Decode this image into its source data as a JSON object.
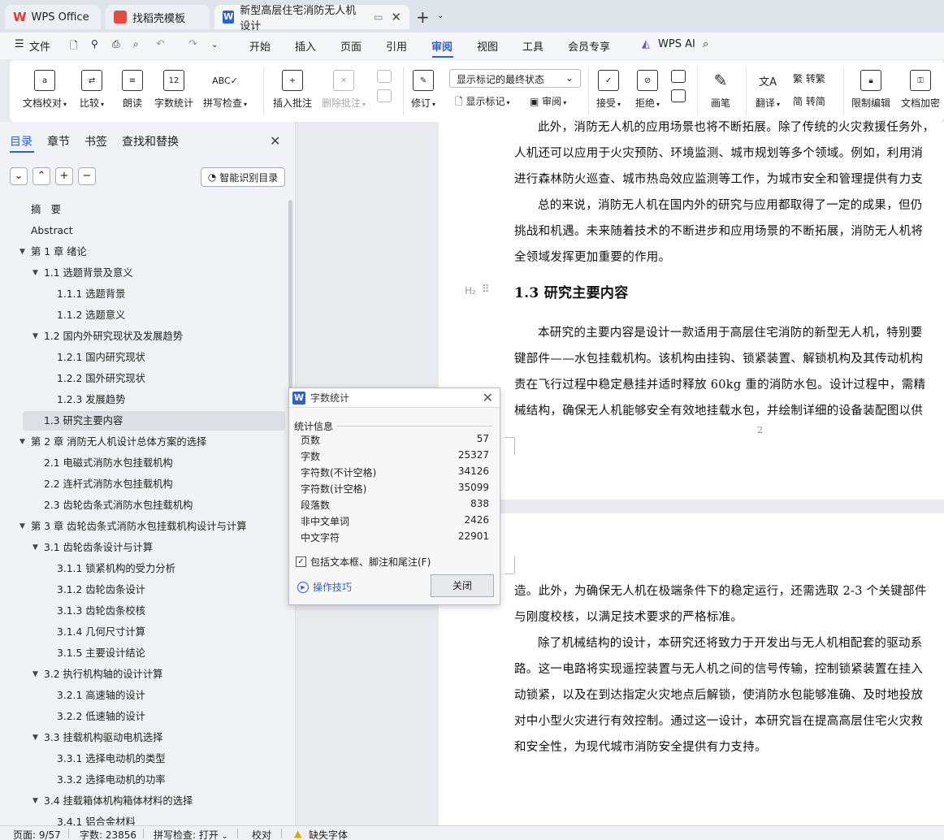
{
  "tabs": {
    "wps": "WPS Office",
    "template": "找稻壳模板",
    "doc": "新型高层住宅消防无人机设计"
  },
  "menu": {
    "file": "文件",
    "items": [
      "开始",
      "插入",
      "页面",
      "引用",
      "审阅",
      "视图",
      "工具",
      "会员专享"
    ],
    "active": "审阅",
    "ai": "WPS AI"
  },
  "ribbon": {
    "doc_check": "文档校对",
    "compare": "比较",
    "read_aloud": "朗读",
    "word_count": "字数统计",
    "spell_check": "拼写检查",
    "insert_comment": "插入批注",
    "delete_comment": "删除批注",
    "revise": "修订",
    "markup_select": "显示标记的最终状态",
    "show_markup": "显示标记",
    "review": "审阅",
    "accept": "接受",
    "reject": "拒绝",
    "pen": "画笔",
    "translate": "翻译",
    "to_traditional": "转繁",
    "to_simplified": "转简",
    "restrict_edit": "限制编辑",
    "encrypt": "文档加密"
  },
  "nav": {
    "tabs": [
      "目录",
      "章节",
      "书签",
      "查找和替换"
    ],
    "smart_btn": "智能识别目录",
    "items": [
      {
        "text": "摘　要",
        "level": 0
      },
      {
        "text": "Abstract",
        "level": 0
      },
      {
        "text": "第 1 章  绪论",
        "level": 0,
        "caret": true
      },
      {
        "text": "1.1  选题背景及意义",
        "level": 1,
        "caret": true
      },
      {
        "text": "1.1.1  选题背景",
        "level": 2
      },
      {
        "text": "1.1.2  选题意义",
        "level": 2
      },
      {
        "text": "1.2  国内外研究现状及发展趋势",
        "level": 1,
        "caret": true
      },
      {
        "text": "1.2.1  国内研究现状",
        "level": 2
      },
      {
        "text": "1.2.2  国外研究现状",
        "level": 2
      },
      {
        "text": "1.2.3  发展趋势",
        "level": 2
      },
      {
        "text": "1.3  研究主要内容",
        "level": 1,
        "selected": true
      },
      {
        "text": "第 2 章  消防无人机设计总体方案的选择",
        "level": 0,
        "caret": true
      },
      {
        "text": "2.1  电磁式消防水包挂载机构",
        "level": 1
      },
      {
        "text": "2.2  连杆式消防水包挂载机构",
        "level": 1
      },
      {
        "text": "2.3  齿轮齿条式消防水包挂载机构",
        "level": 1
      },
      {
        "text": "第 3 章  齿轮齿条式消防水包挂载机构设计与计算",
        "level": 0,
        "caret": true
      },
      {
        "text": "3.1  齿轮齿条设计与计算",
        "level": 1,
        "caret": true
      },
      {
        "text": "3.1.1  锁紧机构的受力分析",
        "level": 2
      },
      {
        "text": "3.1.2  齿轮齿条设计",
        "level": 2
      },
      {
        "text": "3.1.3  齿轮齿条校核",
        "level": 2
      },
      {
        "text": "3.1.4  几何尺寸计算",
        "level": 2
      },
      {
        "text": "3.1.5  主要设计结论",
        "level": 2
      },
      {
        "text": "3.2  执行机构轴的设计计算",
        "level": 1,
        "caret": true
      },
      {
        "text": "3.2.1  高速轴的设计",
        "level": 2
      },
      {
        "text": "3.2.2  低速轴的设计",
        "level": 2
      },
      {
        "text": "3.3    挂载机构驱动电机选择",
        "level": 1,
        "caret": true
      },
      {
        "text": "3.3.1    选择电动机的类型",
        "level": 2
      },
      {
        "text": "3.3.2    选择电动机的功率",
        "level": 2
      },
      {
        "text": "3.4  挂载箱体机构箱体材料的选择",
        "level": 1,
        "caret": true
      },
      {
        "text": "3.4.1  铝合金材料",
        "level": 2
      }
    ]
  },
  "document": {
    "page1_lines": [
      "此外，消防无人机的应用场景也将不断拓展。除了传统的火灾救援任务外，",
      "人机还可以应用于火灾预防、环境监测、城市规划等多个领域。例如，利用消",
      "进行森林防火巡查、城市热岛效应监测等工作，为城市安全和管理提供有力支",
      "总的来说，消防无人机在国内外的研究与应用都取得了一定的成果，但仍",
      "挑战和机遇。未来随着技术的不断进步和应用场景的不断拓展，消防无人机将",
      "全领域发挥更加重要的作用。"
    ],
    "heading_marker": "H₂",
    "heading": "1.3  研究主要内容",
    "page1_lines_b": [
      "本研究的主要内容是设计一款适用于高层住宅消防的新型无人机，特别要",
      "键部件——水包挂载机构。该机构由挂钩、锁紧装置、解锁机构及其传动机构",
      "责在飞行过程中稳定悬挂并适时释放 60kg 重的消防水包。设计过程中，需精",
      "械结构，确保无人机能够安全有效地挂载水包，并绘制详细的设备装配图以供"
    ],
    "page_number": "2",
    "page2_lines": [
      "造。此外，为确保无人机在极端条件下的稳定运行，还需选取 2-3 个关键部件",
      "与刚度校核，以满足技术要求的严格标准。",
      "除了机械结构的设计，本研究还将致力于开发出与无人机相配套的驱动系",
      "路。这一电路将实现遥控装置与无人机之间的信号传输，控制锁紧装置在挂入",
      "动锁紧，以及在到达指定火灾地点后解锁，使消防水包能够准确、及时地投放",
      "对中小型火灾进行有效控制。通过这一设计，本研究旨在提高高层住宅火灾救",
      "和安全性，为现代城市消防安全提供有力支持。"
    ]
  },
  "dialog": {
    "title": "字数统计",
    "group": "统计信息",
    "rows": [
      {
        "label": "页数",
        "value": "57"
      },
      {
        "label": "字数",
        "value": "25327"
      },
      {
        "label": "字符数(不计空格)",
        "value": "34126"
      },
      {
        "label": "字符数(计空格)",
        "value": "35099"
      },
      {
        "label": "段落数",
        "value": "838"
      },
      {
        "label": "非中文单词",
        "value": "2426"
      },
      {
        "label": "中文字符",
        "value": "22901"
      }
    ],
    "checkbox": "包括文本框、脚注和尾注(F)",
    "tips": "操作技巧",
    "close": "关闭"
  },
  "status": {
    "page": "页面: 9/57",
    "words": "字数: 23856",
    "spell": "拼写检查: 打开",
    "proof": "校对",
    "missing_font": "缺失字体"
  },
  "colors": {
    "accent": "#2a62d6",
    "wps_red": "#e33333"
  }
}
